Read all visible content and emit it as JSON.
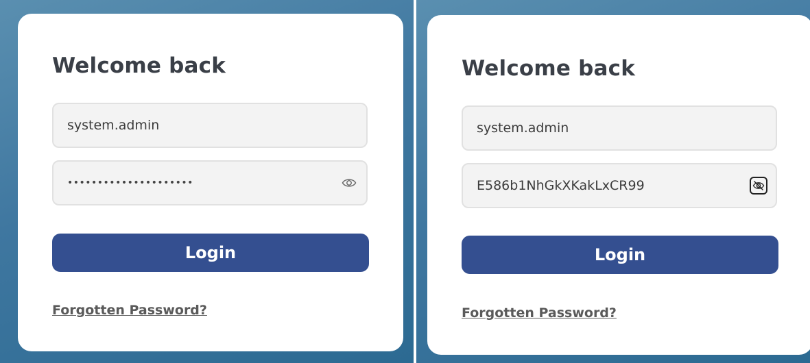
{
  "colors": {
    "background_gradient": [
      "#5a8fb0",
      "#2c6a92"
    ],
    "card": "#ffffff",
    "field_background": "#f3f3f3",
    "primary_button": "#344f90",
    "title_text": "#3a3f47"
  },
  "panels": [
    {
      "title": "Welcome back",
      "username": {
        "value": "system.admin"
      },
      "password": {
        "display": "•••••••••••••••••••••",
        "visible": false,
        "toggle_icon": "eye-icon"
      },
      "login_label": "Login",
      "forgot_label": "Forgotten Password?"
    },
    {
      "title": "Welcome back",
      "username": {
        "value": "system.admin"
      },
      "password": {
        "display": "E586b1NhGkXKakLxCR99",
        "visible": true,
        "toggle_icon": "eye-off-icon"
      },
      "login_label": "Login",
      "forgot_label": "Forgotten Password?"
    }
  ]
}
